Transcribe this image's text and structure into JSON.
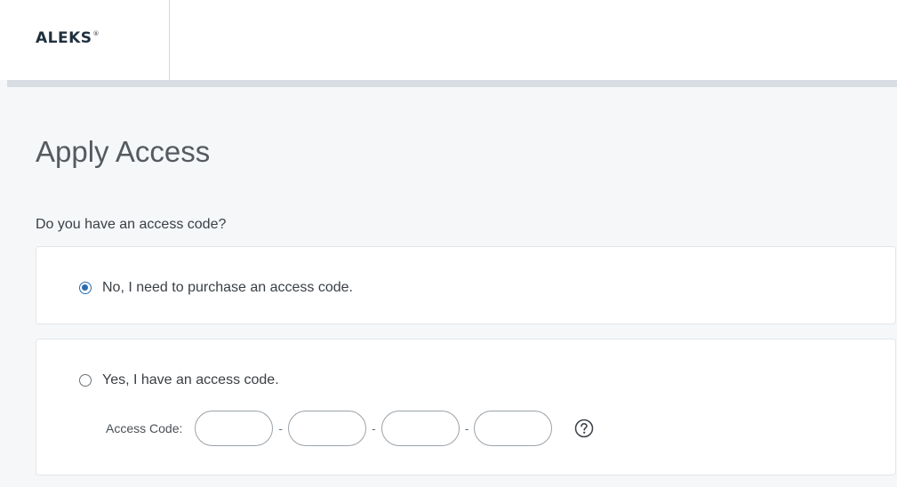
{
  "header": {
    "logo_text": "ALEKS",
    "logo_mark": "®"
  },
  "page": {
    "title": "Apply Access",
    "question": "Do you have an access code?"
  },
  "options": {
    "no": {
      "label": "No, I need to purchase an access code.",
      "selected": true
    },
    "yes": {
      "label": "Yes, I have an access code.",
      "selected": false
    }
  },
  "access_code": {
    "label": "Access Code:",
    "separator": "-",
    "segments": [
      "",
      "",
      "",
      ""
    ],
    "help_icon": "question-circle-icon"
  },
  "colors": {
    "accent": "#2b6cb0",
    "background": "#f5f7f9",
    "header_rule": "#d7dde3"
  }
}
